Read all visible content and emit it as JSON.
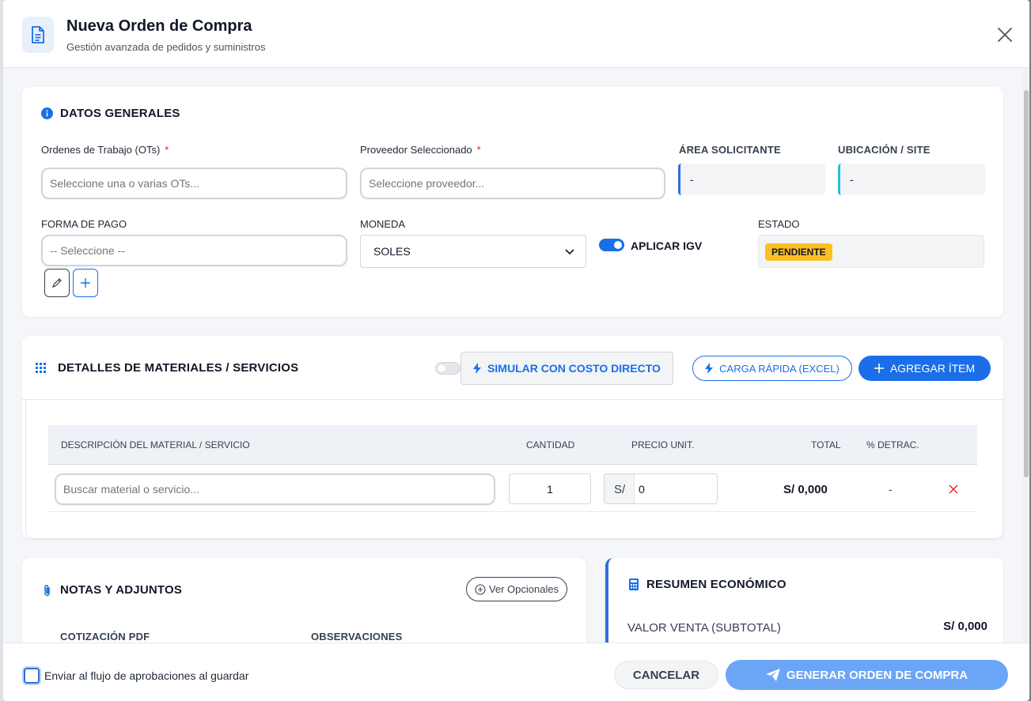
{
  "header": {
    "title": "Nueva Orden de Compra",
    "subtitle": "Gestión avanzada de pedidos y suministros"
  },
  "general": {
    "title": "DATOS GENERALES",
    "ots_label": "Ordenes de Trabajo (OTs)",
    "ots_placeholder": "Seleccione una o varias OTs...",
    "proveedor_label": "Proveedor Seleccionado",
    "proveedor_placeholder": "Seleccione proveedor...",
    "required_mark": "*",
    "area_label": "ÁREA SOLICITANTE",
    "area_value": "-",
    "ubicacion_label": "UBICACIÓN / SITE",
    "ubicacion_value": "-",
    "pago_label": "FORMA DE PAGO",
    "pago_placeholder": "-- Seleccione --",
    "moneda_label": "MONEDA",
    "moneda_value": "SOLES",
    "igv_label": "APLICAR IGV",
    "igv_on": true,
    "estado_label": "ESTADO",
    "estado_value": "PENDIENTE"
  },
  "details": {
    "title": "DETALLES DE MATERIALES / SERVICIOS",
    "simular_label": "SIMULAR CON COSTO DIRECTO",
    "simular_on": false,
    "carga_label": "CARGA RÁPIDA (EXCEL)",
    "agregar_label": "AGREGAR ÍTEM",
    "columns": {
      "descripcion": "DESCRIPCIÓN DEL MATERIAL / SERVICIO",
      "cantidad": "CANTIDAD",
      "precio": "PRECIO UNIT.",
      "total": "TOTAL",
      "detrac": "% DETRAC."
    },
    "row": {
      "search_placeholder": "Buscar material o servicio...",
      "cantidad": "1",
      "currency_prefix": "S/",
      "precio": "0",
      "total": "S/ 0,000",
      "detrac": "-"
    }
  },
  "notas": {
    "title": "NOTAS Y ADJUNTOS",
    "ver_opcionales": "Ver Opcionales",
    "cotizacion_label": "COTIZACIÓN PDF",
    "observaciones_label": "OBSERVACIONES"
  },
  "resumen": {
    "title": "RESUMEN ECONÓMICO",
    "subtotal_label": "VALOR VENTA (SUBTOTAL)",
    "subtotal_value": "S/ 0,000"
  },
  "footer": {
    "checkbox_label": "Enviar al flujo de aprobaciones al guardar",
    "cancel_label": "CANCELAR",
    "generate_label": "GENERAR ORDEN DE COMPRA"
  },
  "colors": {
    "primary": "#1a6fe8",
    "badge": "#fbbf24",
    "danger": "#dc2626"
  }
}
